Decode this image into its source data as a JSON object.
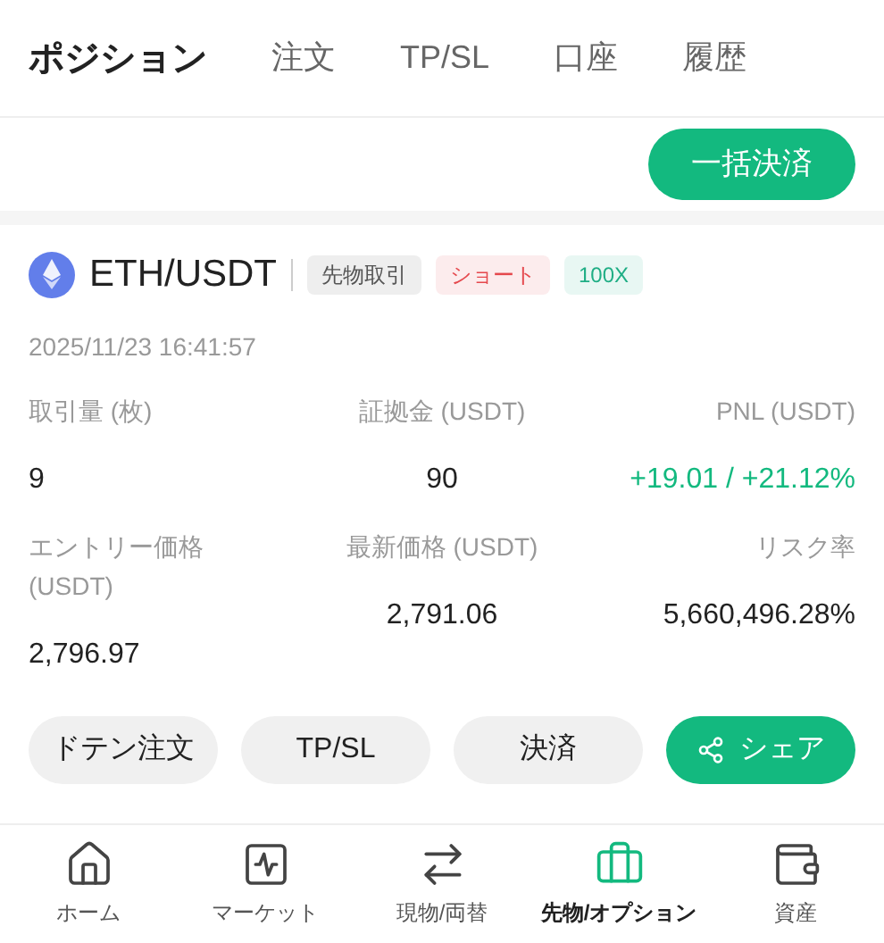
{
  "tabs": [
    {
      "label": "ポジション",
      "selected": true
    },
    {
      "label": "注文",
      "selected": false
    },
    {
      "label": "TP/SL",
      "selected": false
    },
    {
      "label": "口座",
      "selected": false
    },
    {
      "label": "履歴",
      "selected": false
    }
  ],
  "close_all_button": "一括決済",
  "position": {
    "symbol": "ETH/USDT",
    "tags": [
      {
        "label": "先物取引",
        "color": "#555555"
      },
      {
        "label": "ショート",
        "color": "#e5484d"
      },
      {
        "label": "100X",
        "color": "#1fae85"
      }
    ],
    "timestamp": "2025/11/23 16:41:57",
    "stats": [
      {
        "label": "取引量 (枚)",
        "value": "9",
        "kind": "plain"
      },
      {
        "label": "証拠金 (USDT)",
        "value": "90",
        "kind": "plain"
      },
      {
        "label": "PNL (USDT)",
        "value": "+19.01 / +21.12%",
        "kind": "profit"
      },
      {
        "label": "エントリー価格 (USDT)",
        "value": "2,796.97",
        "kind": "plain"
      },
      {
        "label": "最新価格 (USDT)",
        "value": "2,791.06",
        "kind": "plain"
      },
      {
        "label": "リスク率",
        "value": "5,660,496.28%",
        "kind": "plain"
      }
    ],
    "actions": [
      {
        "label": "ドテン注文",
        "kind": "secondary"
      },
      {
        "label": "TP/SL",
        "kind": "secondary"
      },
      {
        "label": "決済",
        "kind": "secondary"
      },
      {
        "label": "シェア",
        "kind": "primary"
      }
    ]
  },
  "bottom_nav": [
    {
      "label": "ホーム",
      "selected": false
    },
    {
      "label": "マーケット",
      "selected": false
    },
    {
      "label": "現物/両替",
      "selected": false
    },
    {
      "label": "先物/オプション",
      "selected": true
    },
    {
      "label": "資産",
      "selected": false
    }
  ]
}
